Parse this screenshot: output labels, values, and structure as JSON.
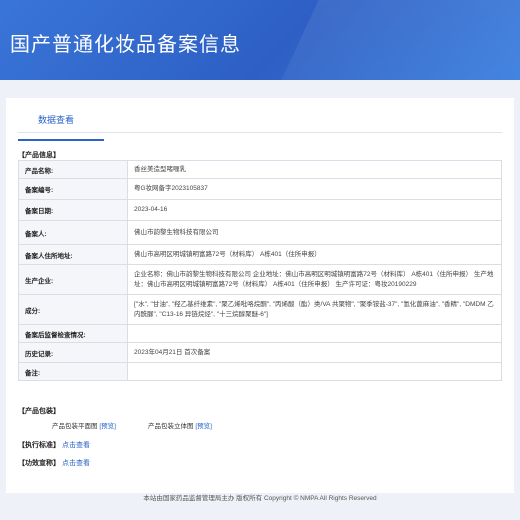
{
  "header": {
    "title": "国产普通化妆品备案信息"
  },
  "tabs": [
    {
      "label": "数据查看"
    }
  ],
  "product_info": {
    "section_label": "【产品信息】",
    "rows": [
      {
        "label": "产品名称:",
        "value": "香丝美造型啫喱乳"
      },
      {
        "label": "备案编号:",
        "value": "粤G妆网备字2023105837"
      },
      {
        "label": "备案日期:",
        "value": "2023-04-16"
      },
      {
        "label": "备案人:",
        "value": "佛山市韵黎生物科技有限公司"
      },
      {
        "label": "备案人住所地址:",
        "value": "佛山市高明区明城镇明富路72号（材料库） A栋401（住所申报）"
      },
      {
        "label": "生产企业:",
        "value": "企业名称：佛山市韵黎生物科技有限公司 企业地址：佛山市高明区明城镇明富路72号（材料库） A栋401（住所申报） 生产地址：佛山市高明区明城镇明富路72号（材料库） A栋401（住所申报） 生产许可证：粤妆20190229"
      },
      {
        "label": "成分:",
        "value": "[\"水\", \"甘油\", \"羟乙基纤维素\", \"聚乙烯吡咯烷酮\", \"丙烯酸（酯）类/VA 共聚物\", \"聚季铵盐-37\", \"氢化蓖麻油\", \"香精\", \"DMDM 乙内酰脲\", \"C13-16 异链烷烃\", \"十三烷醇聚醚-6\"]"
      },
      {
        "label": "备案后监督检查情况:",
        "value": ""
      },
      {
        "label": "历史记录:",
        "value": "2023年04月21日 首次备案"
      },
      {
        "label": "备注:",
        "value": ""
      }
    ]
  },
  "packaging": {
    "section_label": "【产品包装】",
    "flat_label": "产品包装平面图",
    "solid_label": "产品包装立体图",
    "preview_label": "[预览]"
  },
  "standard": {
    "section_label": "【执行标准】",
    "link": "点击查看"
  },
  "efficacy": {
    "section_label": "【功效宣称】",
    "link": "点击查看"
  },
  "footer": {
    "text": "本站由国家药品监督管理局主办 版权所有 Copyright © NMPA All Rights Reserved"
  }
}
